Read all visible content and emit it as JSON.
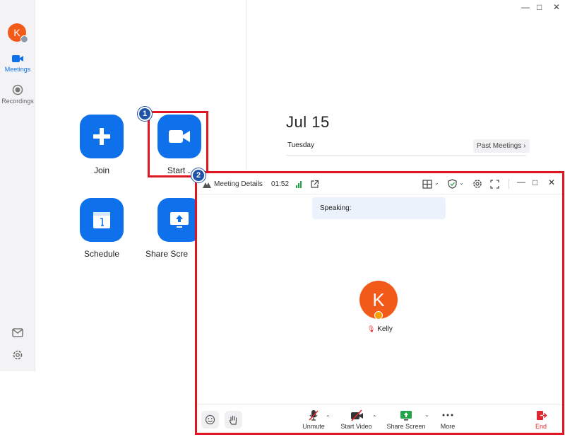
{
  "sidebar": {
    "avatar_initial": "K",
    "items": [
      {
        "label": "Meetings",
        "icon": "video-camera-icon",
        "active": true
      },
      {
        "label": "Recordings",
        "icon": "record-icon",
        "active": false
      }
    ],
    "bottom_icons": [
      "mail-icon",
      "settings-icon"
    ]
  },
  "home": {
    "tiles": [
      {
        "label": "Join",
        "icon": "plus-icon"
      },
      {
        "label": "Start",
        "icon": "video-camera-icon",
        "has_dropdown": true
      },
      {
        "label": "Schedule",
        "icon": "calendar-icon"
      },
      {
        "label": "Share Scre",
        "icon": "share-screen-icon"
      }
    ]
  },
  "calendar": {
    "date": "Jul 15",
    "day": "Tuesday",
    "past_meetings_label": "Past Meetings"
  },
  "annotations": {
    "step1": "1",
    "step2": "2",
    "highlight_color": "#e0151f",
    "badge_color": "#1f53a7"
  },
  "meeting": {
    "title": "Meeting Details",
    "elapsed": "01:52",
    "speaking_label": "Speaking:",
    "participant": {
      "initial": "K",
      "name": "Kelly"
    },
    "toolbar": {
      "unmute": "Unmute",
      "start_video": "Start Video",
      "share_screen": "Share Screen",
      "more": "More",
      "end": "End"
    }
  },
  "colors": {
    "accent": "#0e71eb",
    "avatar": "#f25a1a",
    "end": "#e0262f"
  }
}
